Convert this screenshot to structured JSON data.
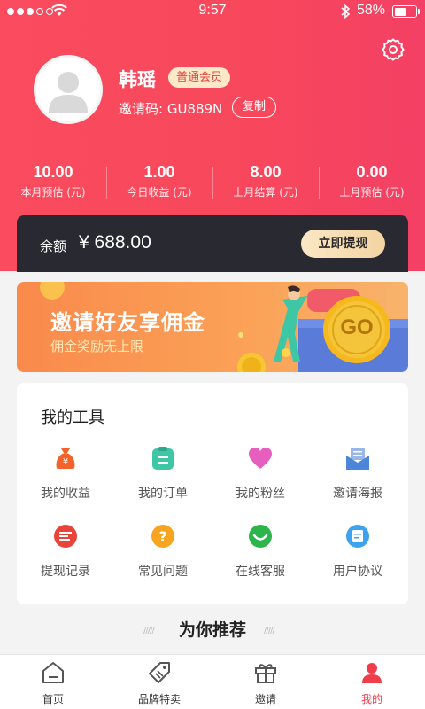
{
  "status_bar": {
    "time": "9:57",
    "battery": "58%",
    "battery_level": 0.58
  },
  "profile": {
    "name": "韩瑶",
    "member_level": "普通会员",
    "invite_code": "邀请码: GU889N",
    "copy_label": "复制"
  },
  "stats": [
    {
      "value": "10.00",
      "label": "本月预估 (元)"
    },
    {
      "value": "1.00",
      "label": "今日收益 (元)"
    },
    {
      "value": "8.00",
      "label": "上月结算 (元)"
    },
    {
      "value": "0.00",
      "label": "上月预估 (元)"
    }
  ],
  "balance": {
    "label": "余额",
    "value": "¥ 688.00",
    "withdraw_label": "立即提现"
  },
  "banner": {
    "title": "邀请好友享佣金",
    "subtitle": "佣金奖励无上限",
    "go_label": "GO"
  },
  "tools": {
    "title": "我的工具",
    "items": [
      {
        "label": "我的收益",
        "icon": "income-bag-icon",
        "color": "#f1632a"
      },
      {
        "label": "我的订单",
        "icon": "order-icon",
        "color": "#3ec6a5"
      },
      {
        "label": "我的粉丝",
        "icon": "heart-icon",
        "color": "#e65fbe"
      },
      {
        "label": "邀请海报",
        "icon": "poster-mail-icon",
        "color": "#4b86d8"
      },
      {
        "label": "提现记录",
        "icon": "withdraw-record-icon",
        "color": "#e9433a"
      },
      {
        "label": "常见问题",
        "icon": "question-icon",
        "color": "#f7a521"
      },
      {
        "label": "在线客服",
        "icon": "customer-service-icon",
        "color": "#2bb54b"
      },
      {
        "label": "用户协议",
        "icon": "agreement-icon",
        "color": "#3ea2ef"
      }
    ]
  },
  "recommend": {
    "title": "为你推荐"
  },
  "tabbar": [
    {
      "label": "首页",
      "icon": "home-icon"
    },
    {
      "label": "品牌特卖",
      "icon": "tag-icon"
    },
    {
      "label": "邀请",
      "icon": "gift-icon"
    },
    {
      "label": "我的",
      "icon": "user-icon",
      "active": true
    }
  ],
  "colors": {
    "primary": "#f8475c",
    "accent": "#f03d4b",
    "dark_card": "#292a31"
  }
}
